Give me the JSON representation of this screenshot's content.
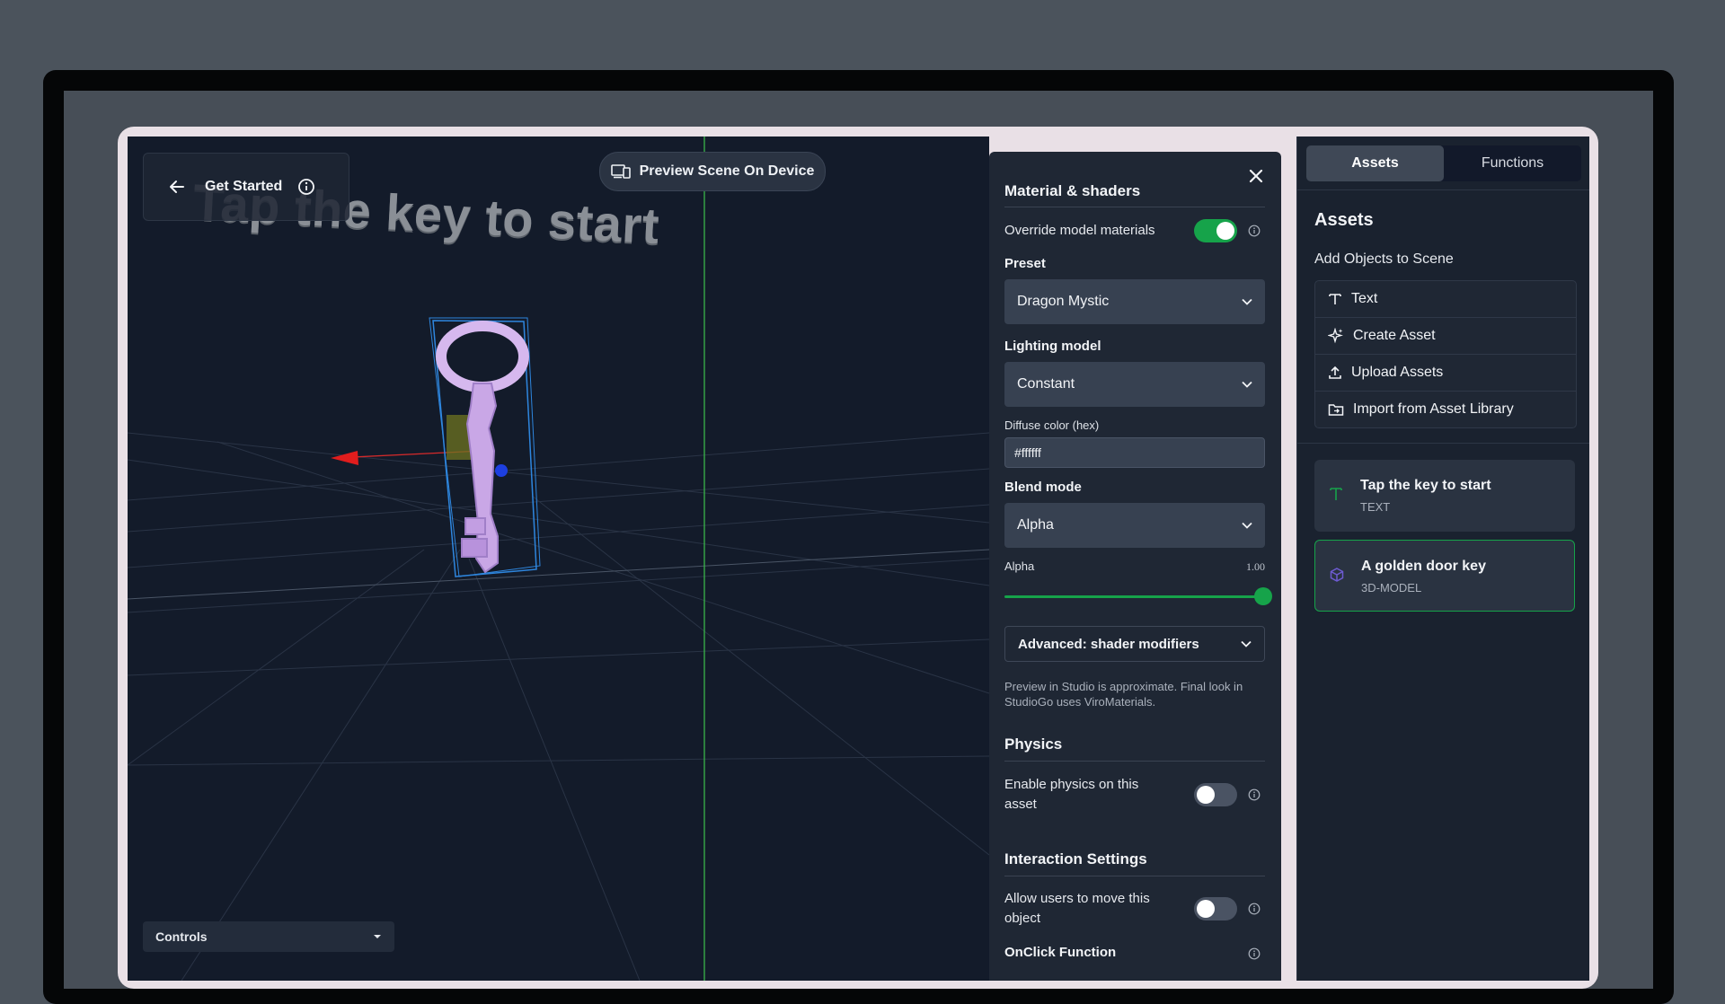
{
  "viewport": {
    "back_label": "Back",
    "header_title": "Get Started",
    "scene_text": "Tap the key to start",
    "preview_button": "Preview Scene On Device",
    "controls_label": "Controls"
  },
  "material_panel": {
    "title": "Material & shaders",
    "override_label": "Override model materials",
    "override_on": true,
    "preset_label": "Preset",
    "preset_value": "Dragon Mystic",
    "lighting_label": "Lighting model",
    "lighting_value": "Constant",
    "diffuse_label": "Diffuse color (hex)",
    "diffuse_value": "#ffffff",
    "blend_label": "Blend mode",
    "blend_value": "Alpha",
    "alpha_label": "Alpha",
    "alpha_value": "1.00",
    "alpha_fraction": 1.0,
    "advanced_label": "Advanced: shader modifiers",
    "note": "Preview in Studio is approximate. Final look in StudioGo uses ViroMaterials.",
    "physics_title": "Physics",
    "physics_label": "Enable physics on this asset",
    "physics_on": false,
    "interaction_title": "Interaction Settings",
    "move_label": "Allow users to move this object",
    "move_on": false,
    "onclick_label": "OnClick Function"
  },
  "sidebar": {
    "tab_assets": "Assets",
    "tab_functions": "Functions",
    "title": "Assets",
    "subtitle": "Add Objects to Scene",
    "menu": [
      {
        "label": "Text",
        "icon": "text-icon"
      },
      {
        "label": "Create Asset",
        "icon": "sparkle-icon"
      },
      {
        "label": "Upload Assets",
        "icon": "upload-icon"
      },
      {
        "label": "Import from Asset Library",
        "icon": "folder-icon"
      }
    ],
    "scene_objects": [
      {
        "title": "Tap the key to start",
        "type": "TEXT",
        "icon": "text-icon",
        "selected": false
      },
      {
        "title": "A golden door key",
        "type": "3D-MODEL",
        "icon": "cube-icon",
        "selected": true
      }
    ]
  },
  "colors": {
    "accent_green": "#16a34a",
    "panel_bg": "#1f2734",
    "viewport_bg": "#131b2a",
    "cube_purple": "#6d5bd0"
  }
}
